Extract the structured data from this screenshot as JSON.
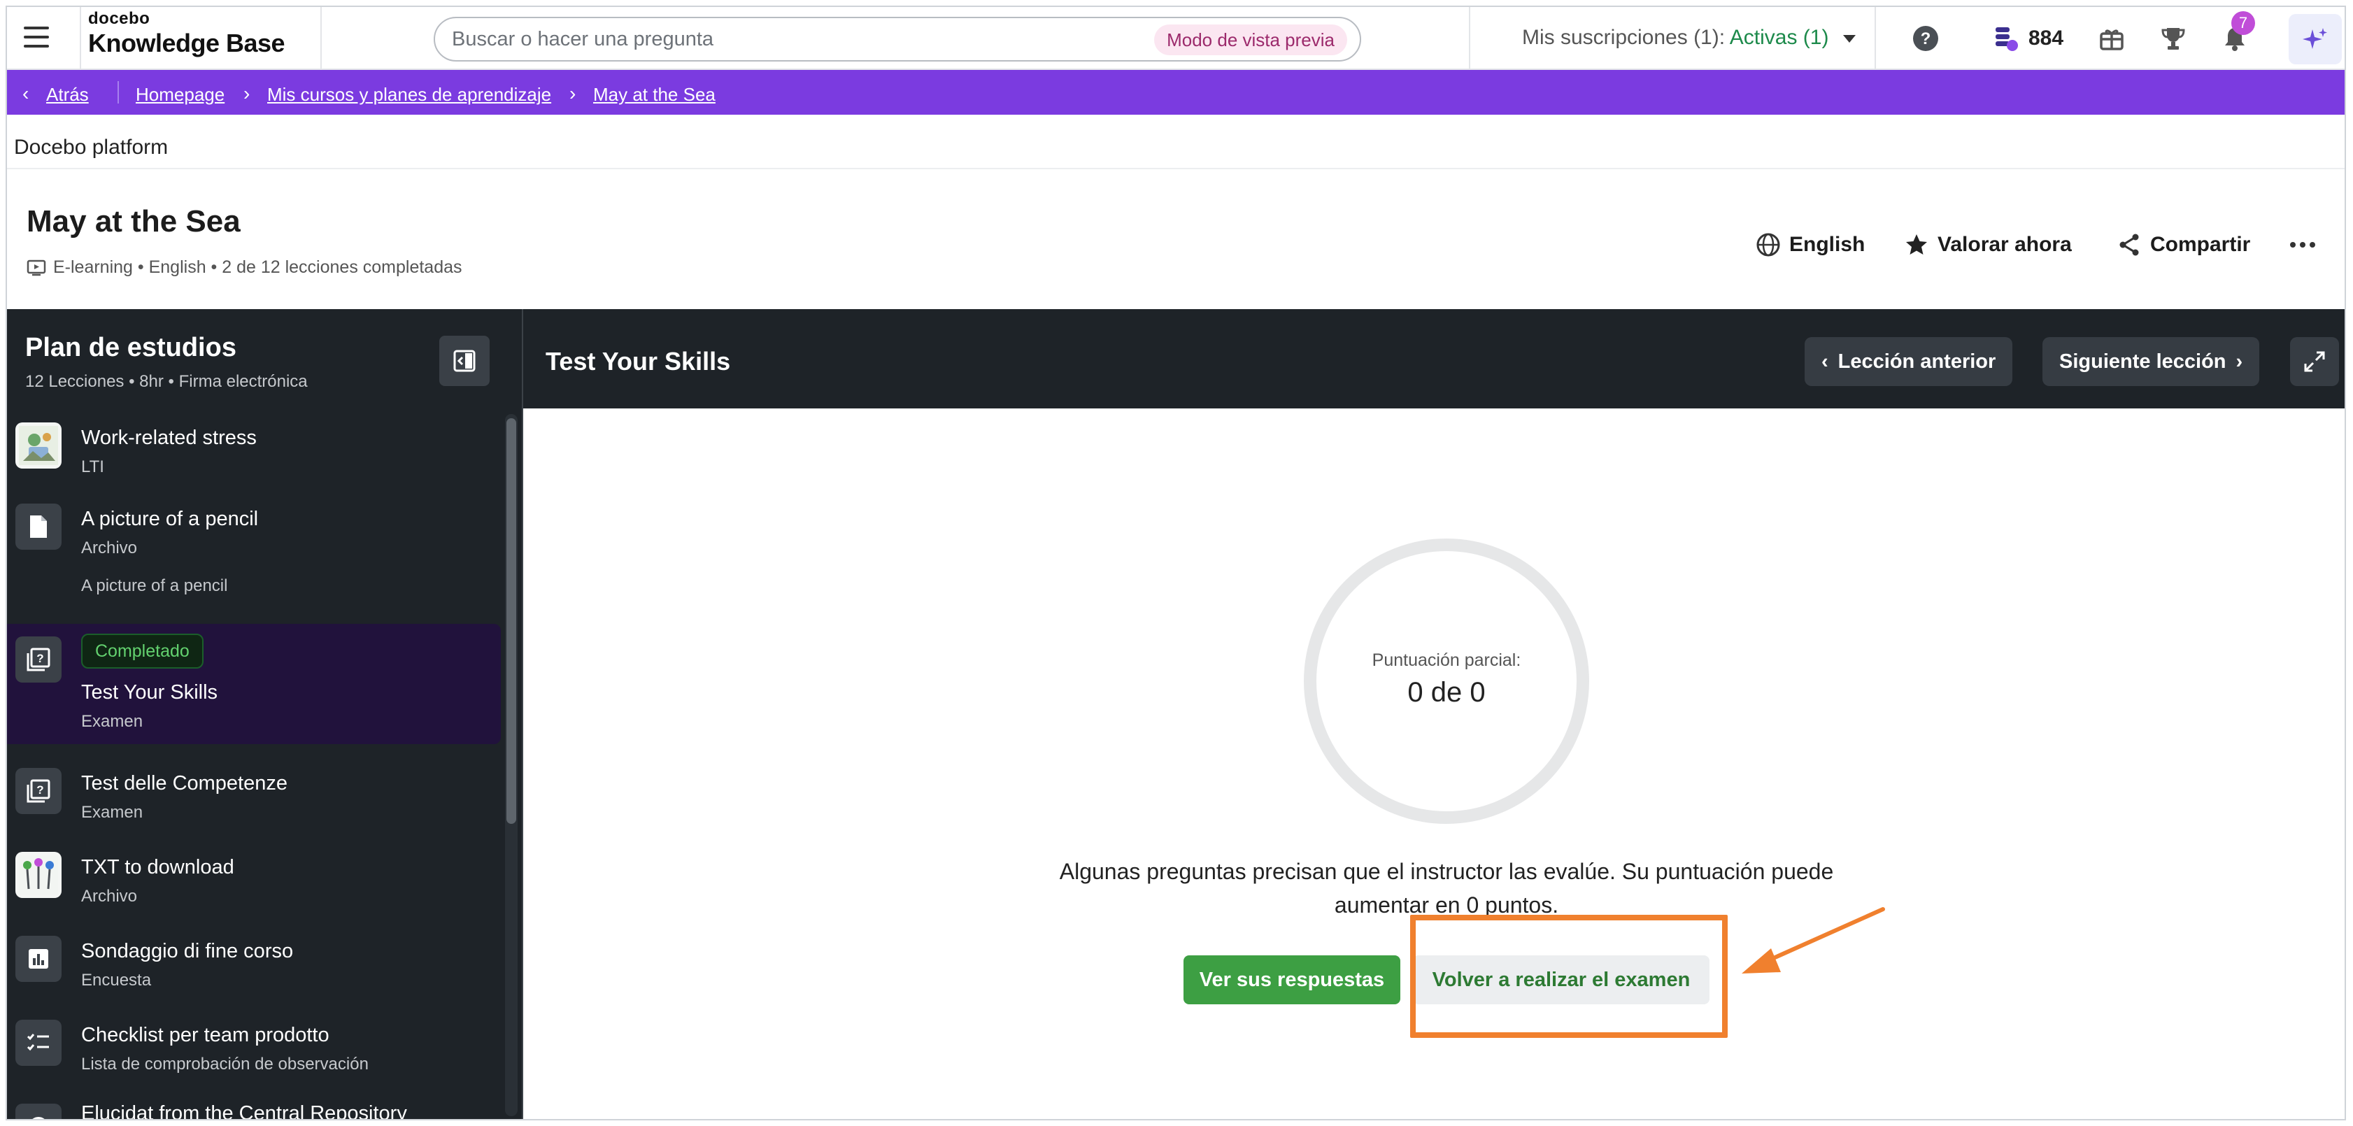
{
  "header": {
    "brand": "docebo",
    "product": "Knowledge Base",
    "search_placeholder": "Buscar o hacer una pregunta",
    "preview_mode_label": "Modo de vista previa",
    "subscriptions_prefix": "Mis suscripciones (1):",
    "subscriptions_status": "Activas (1)",
    "coins": "884",
    "notifications_count": "7"
  },
  "breadcrumb": {
    "back": "Atrás",
    "items": [
      "Homepage",
      "Mis cursos y planes de aprendizaje",
      "May at the Sea"
    ]
  },
  "platform_label": "Docebo platform",
  "course": {
    "title": "May at the Sea",
    "meta": "E-learning • English • 2 de 12 lecciones completadas",
    "actions": {
      "language": "English",
      "rate": "Valorar ahora",
      "share": "Compartir"
    }
  },
  "sidebar": {
    "title": "Plan de estudios",
    "subtitle": "12 Lecciones •  8hr •  Firma electrónica",
    "lessons": [
      {
        "name": "Work-related stress",
        "type": "LTI",
        "icon": "image-thumb-icon"
      },
      {
        "name": "A picture of a pencil",
        "type": "Archivo",
        "extra": "A picture of a pencil",
        "icon": "file-icon"
      },
      {
        "name": "Test Your Skills",
        "type": "Examen",
        "status": "Completado",
        "icon": "quiz-icon",
        "active": true
      },
      {
        "name": "Test delle Competenze",
        "type": "Examen",
        "icon": "quiz-icon"
      },
      {
        "name": "TXT to download",
        "type": "Archivo",
        "icon": "image-thumb-icon"
      },
      {
        "name": "Sondaggio di fine corso",
        "type": "Encuesta",
        "icon": "poll-icon"
      },
      {
        "name": "Checklist per team prodotto",
        "type": "Lista de comprobación de observación",
        "icon": "checklist-icon"
      },
      {
        "name": "Elucidat from the Central Repository",
        "type": "",
        "icon": "circle-icon"
      }
    ]
  },
  "player": {
    "lesson_title": "Test Your Skills",
    "prev_label": "Lección anterior",
    "next_label": "Siguiente lección",
    "score_label": "Puntuación parcial:",
    "score_value": "0 de 0",
    "message": "Algunas preguntas precisan que el instructor las evalúe. Su puntuación puede aumentar en 0 puntos.",
    "view_answers_label": "Ver sus respuestas",
    "retake_label": "Volver a realizar el examen"
  },
  "colors": {
    "accent_purple": "#7b3be0",
    "dark_panel": "#1e2328",
    "success_green": "#3d9f43",
    "annotation_orange": "#f0802e"
  }
}
